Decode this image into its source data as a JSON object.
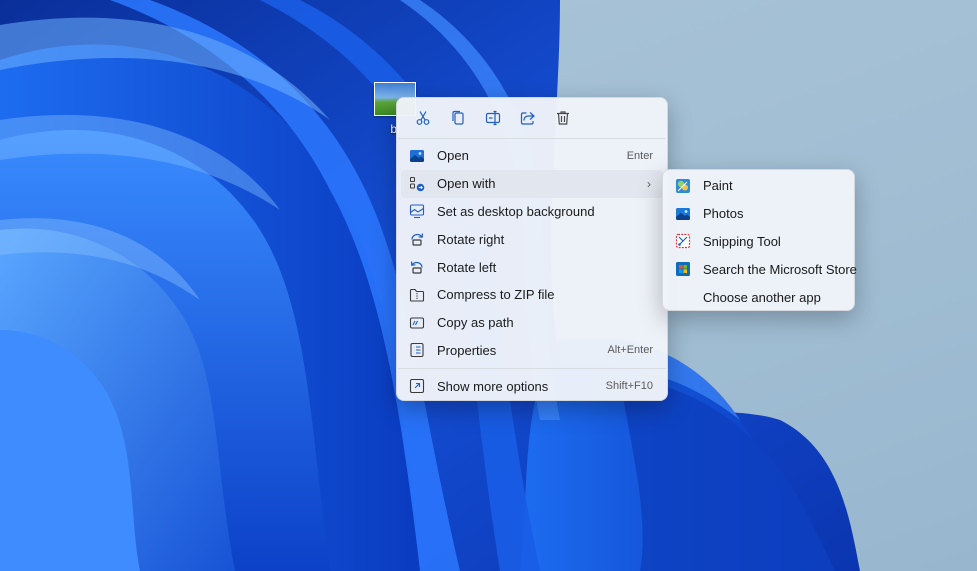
{
  "desktop": {
    "icon_label": "bl"
  },
  "toolbar": {
    "items": [
      {
        "name": "cut",
        "icon": "scissors-icon"
      },
      {
        "name": "copy",
        "icon": "copy-icon"
      },
      {
        "name": "rename",
        "icon": "rename-icon"
      },
      {
        "name": "share",
        "icon": "share-icon"
      },
      {
        "name": "delete",
        "icon": "trash-icon"
      }
    ]
  },
  "menu": {
    "items": [
      {
        "label": "Open",
        "shortcut": "Enter",
        "icon": "image-icon"
      },
      {
        "label": "Open with",
        "shortcut": "",
        "icon": "open-with-icon",
        "has_submenu": true
      },
      {
        "label": "Set as desktop background",
        "shortcut": "",
        "icon": "wallpaper-icon"
      },
      {
        "label": "Rotate right",
        "shortcut": "",
        "icon": "rotate-right-icon"
      },
      {
        "label": "Rotate left",
        "shortcut": "",
        "icon": "rotate-left-icon"
      },
      {
        "label": "Compress to ZIP file",
        "shortcut": "",
        "icon": "zip-icon"
      },
      {
        "label": "Copy as path",
        "shortcut": "",
        "icon": "path-icon"
      },
      {
        "label": "Properties",
        "shortcut": "Alt+Enter",
        "icon": "properties-icon"
      }
    ],
    "more": {
      "label": "Show more options",
      "shortcut": "Shift+F10",
      "icon": "more-options-icon"
    }
  },
  "submenu": {
    "items": [
      {
        "label": "Paint",
        "icon": "paint-icon"
      },
      {
        "label": "Photos",
        "icon": "photos-icon"
      },
      {
        "label": "Snipping Tool",
        "icon": "snipping-tool-icon"
      },
      {
        "label": "Search the Microsoft Store",
        "icon": "store-icon"
      },
      {
        "label": "Choose another app",
        "icon": ""
      }
    ]
  },
  "colors": {
    "accent": "#1f5fbf",
    "menu_bg": "#f0f3f9",
    "highlight": "#e2e6ee"
  }
}
